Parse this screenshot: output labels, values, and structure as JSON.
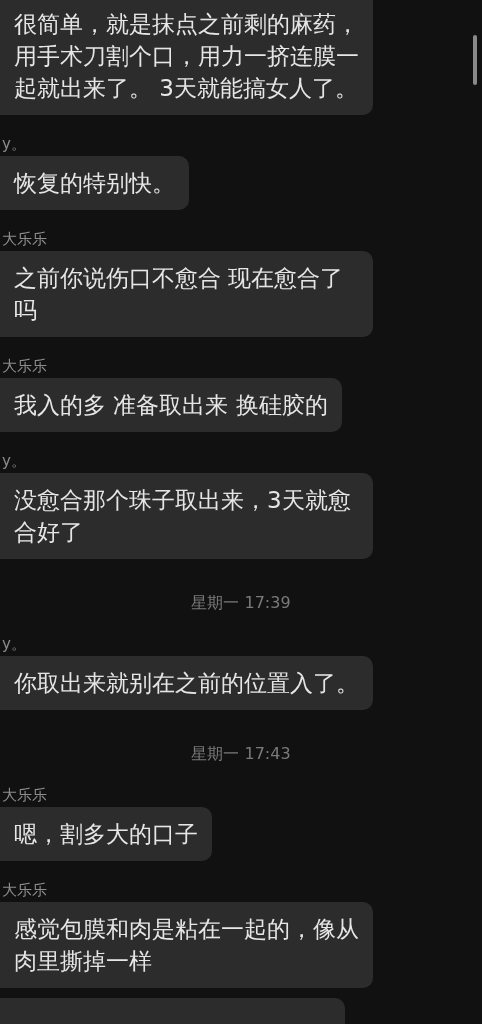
{
  "messages": [
    {
      "kind": "message",
      "text": "很简单，就是抹点之前剩的麻药，用手术刀割个口，用力一挤连膜一起就出来了。 3天就能搞女人了。"
    },
    {
      "kind": "message",
      "sender": "y。",
      "text": "恢复的特别快。"
    },
    {
      "kind": "message",
      "sender": "大乐乐",
      "text": "之前你说伤口不愈合 现在愈合了吗"
    },
    {
      "kind": "message",
      "sender": "大乐乐",
      "text": "我入的多 准备取出来 换硅胶的"
    },
    {
      "kind": "message",
      "sender": "y。",
      "text": "没愈合那个珠子取出来，3天就愈合好了"
    },
    {
      "kind": "time",
      "text": "星期一 17:39"
    },
    {
      "kind": "message",
      "sender": "y。",
      "text": "你取出来就别在之前的位置入了。"
    },
    {
      "kind": "time",
      "text": "星期一 17:43"
    },
    {
      "kind": "message",
      "sender": "大乐乐",
      "text": "嗯，割多大的口子"
    },
    {
      "kind": "message",
      "sender": "大乐乐",
      "text": "感觉包膜和肉是粘在一起的，像从肉里撕掉一样"
    }
  ]
}
